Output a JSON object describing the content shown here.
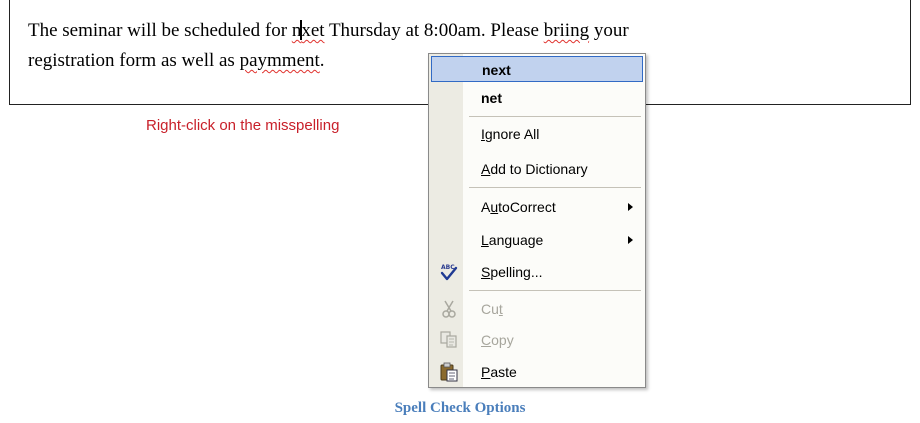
{
  "document": {
    "line1_before": "The seminar will be scheduled for ",
    "line1_miss1_a": "n",
    "line1_miss1_b": "xet",
    "line1_middle": " Thursday at 8:00am.  Please ",
    "line1_miss2": "briing",
    "line1_after": " your",
    "line2_before": "registration form as well as ",
    "line2_miss": "paymment",
    "line2_after": "."
  },
  "hint": "Right-click on the misspelling",
  "menu": {
    "suggestion1": "next",
    "suggestion2": "net",
    "ignore_all_u": "I",
    "ignore_all_rest": "gnore All",
    "add_dict_u": "A",
    "add_dict_rest": "dd to Dictionary",
    "autocorrect_a": "A",
    "autocorrect_u": "u",
    "autocorrect_rest": "toCorrect",
    "language_u": "L",
    "language_rest": "anguage",
    "spelling_u": "S",
    "spelling_rest": "pelling...",
    "cut_a": "Cu",
    "cut_u": "t",
    "copy_u": "C",
    "copy_rest": "opy",
    "paste_u": "P",
    "paste_rest": "aste",
    "selected_item": "next"
  },
  "icons": {
    "spelling": "spelling-check-icon",
    "cut": "scissors-icon",
    "copy": "copy-icon",
    "paste": "clipboard-icon"
  },
  "caption": "Spell Check Options"
}
